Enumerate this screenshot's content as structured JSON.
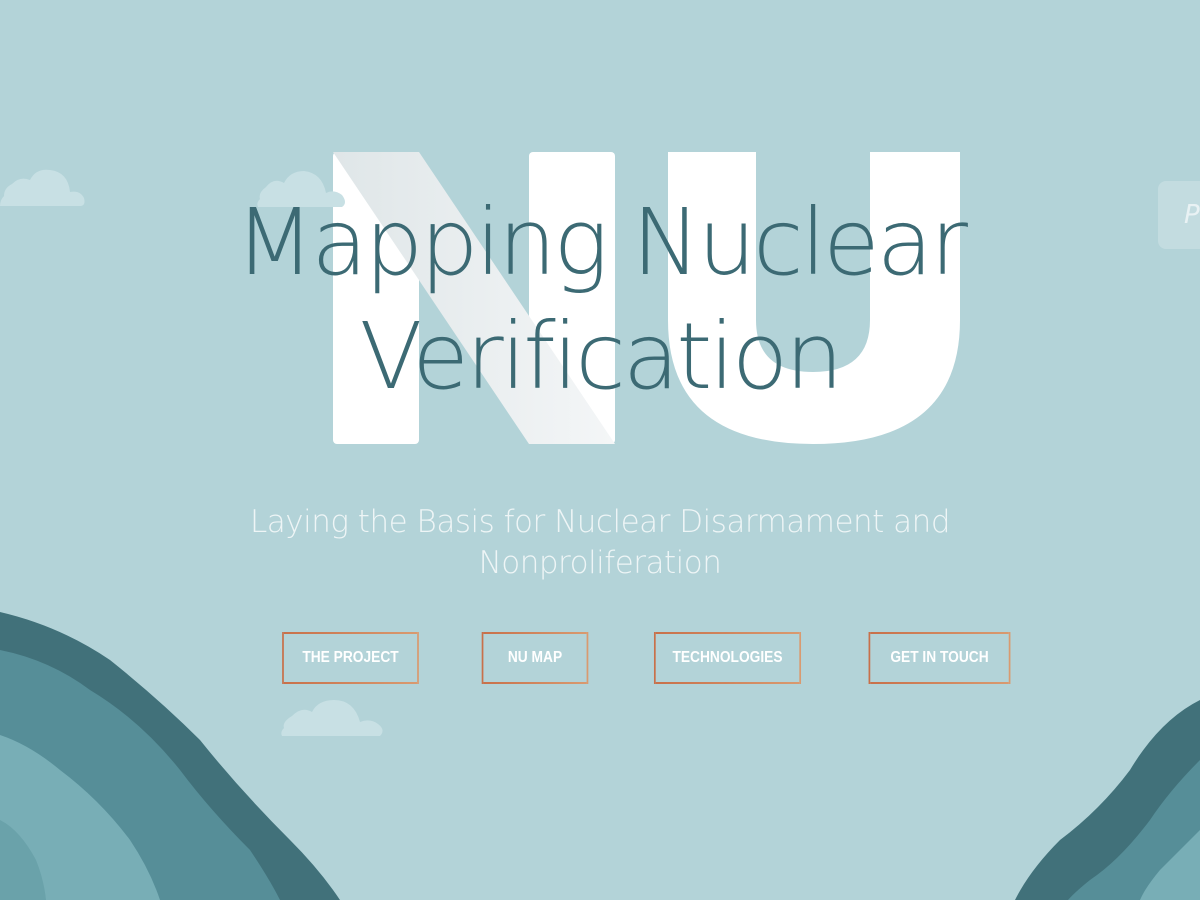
{
  "background_letters": "NU",
  "hero": {
    "title_line1": "Mapping Nuclear",
    "title_line2": "Verification",
    "subtitle_line1": "Laying the Basis for Nuclear Disarmament and",
    "subtitle_line2": "Nonproliferation"
  },
  "nav": {
    "buttons": [
      {
        "label": "THE PROJECT"
      },
      {
        "label": "NU MAP"
      },
      {
        "label": "TECHNOLOGIES"
      },
      {
        "label": "GET IN TOUCH"
      }
    ]
  },
  "corner_button": {
    "label": "P"
  },
  "colors": {
    "background": "#b3d3d8",
    "title": "#3c6a74",
    "button_border": "#cc7f55",
    "mountain_dark": "#41717a",
    "mountain_mid": "#568e98",
    "mountain_light": "#78aeb6"
  }
}
